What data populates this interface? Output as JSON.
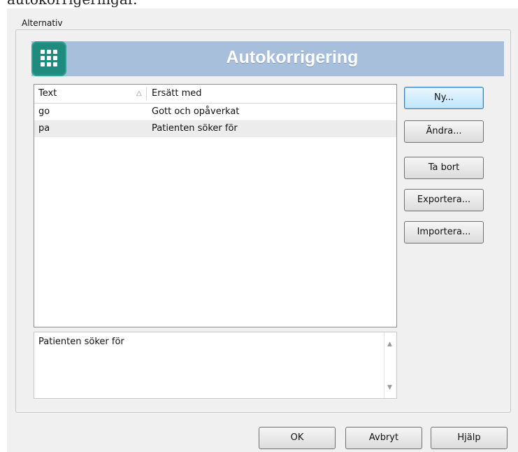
{
  "page_fragment": "autokorrigeringar.",
  "dialog": {
    "group_label": "Alternativ",
    "banner": {
      "icon": "keypad-grid-icon",
      "title": "Autokorrigering",
      "color": "#a7bfda"
    },
    "list": {
      "columns": [
        "Text",
        "Ersätt med"
      ],
      "sort_indicator": "△",
      "rows": [
        {
          "text": "go",
          "replace": "Gott och opåverkat",
          "selected": false
        },
        {
          "text": "pa",
          "replace": "Patienten söker för",
          "selected": true
        }
      ]
    },
    "preview_text": "Patienten söker för",
    "side_buttons": {
      "new": "Ny...",
      "edit": "Ändra...",
      "delete": "Ta bort",
      "export": "Exportera...",
      "import": "Importera..."
    },
    "footer_buttons": {
      "ok": "OK",
      "cancel": "Avbryt",
      "help": "Hjälp"
    }
  }
}
